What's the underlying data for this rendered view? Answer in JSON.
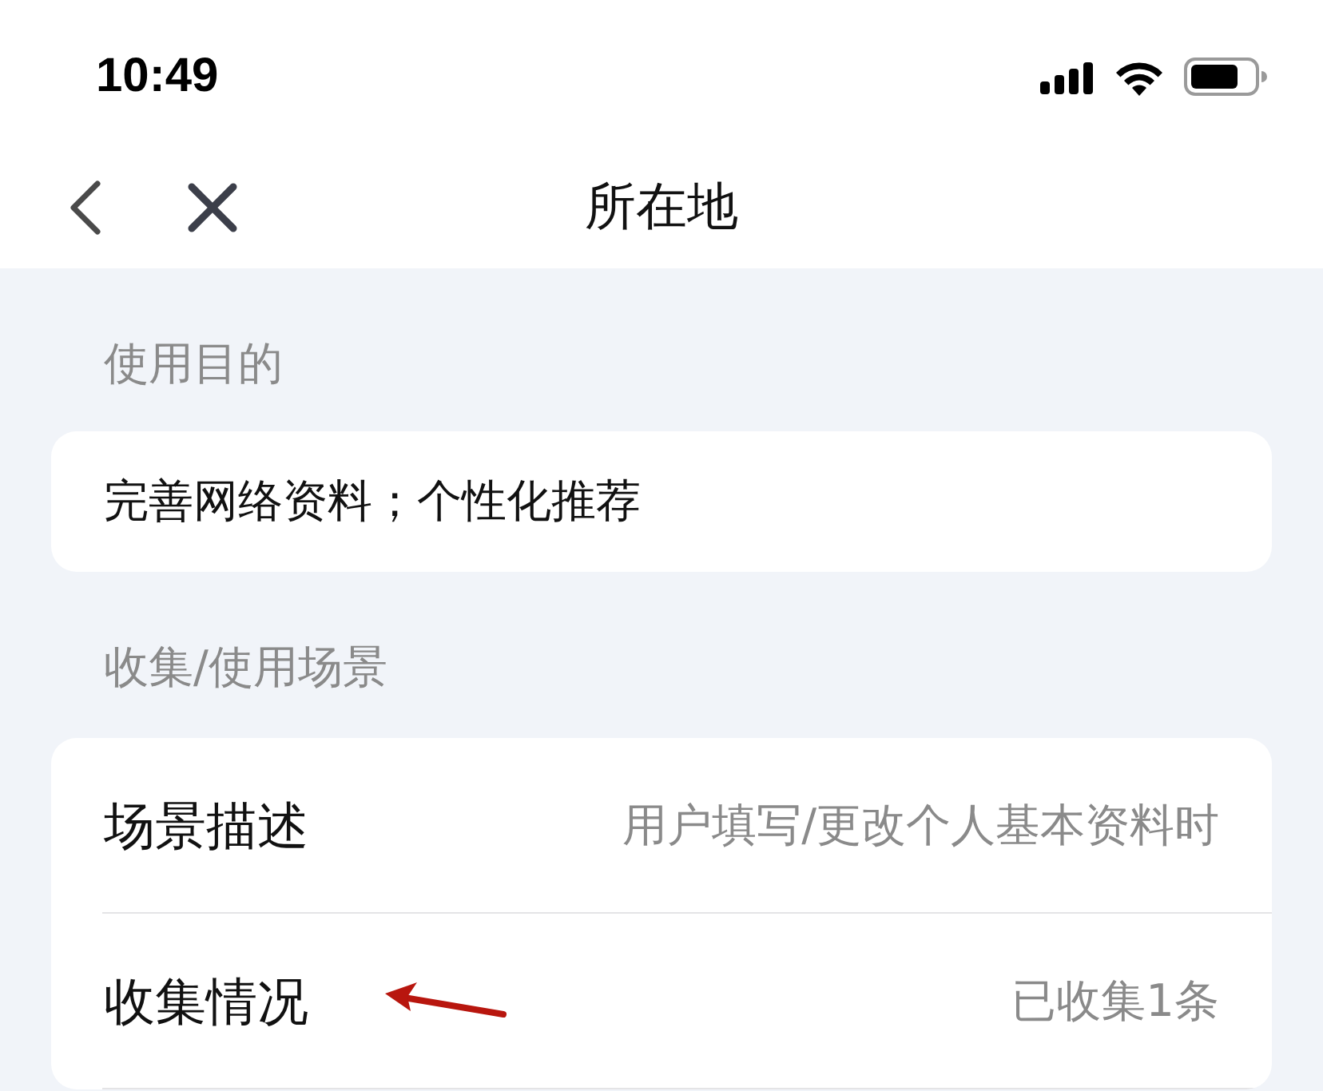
{
  "status_bar": {
    "time": "10:49"
  },
  "nav": {
    "title": "所在地"
  },
  "sections": [
    {
      "header": "使用目的",
      "rows": [
        {
          "kind": "text",
          "text": "完善网络资料；个性化推荐"
        }
      ]
    },
    {
      "header": "收集/使用场景",
      "rows": [
        {
          "kind": "pair",
          "label": "场景描述",
          "value": "用户填写/更改个人基本资料时"
        },
        {
          "kind": "pair",
          "label": "收集情况",
          "value": "已收集1条"
        }
      ]
    }
  ]
}
